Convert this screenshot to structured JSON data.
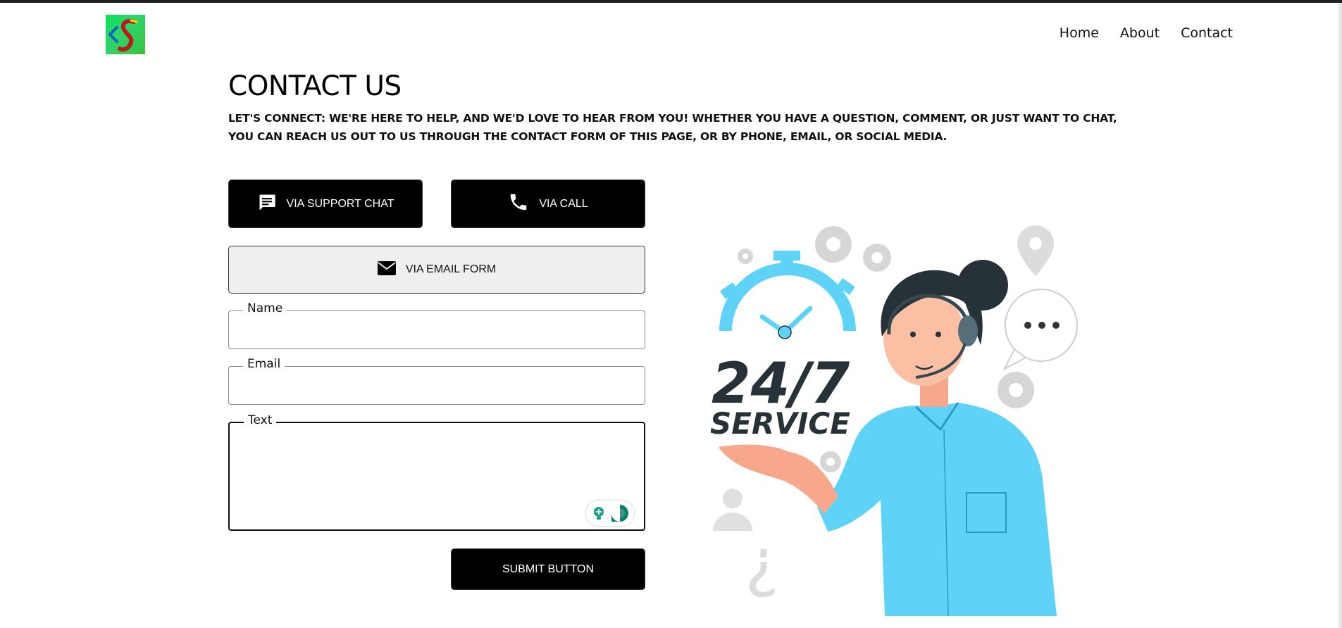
{
  "nav": {
    "items": [
      "Home",
      "About",
      "Contact"
    ]
  },
  "page": {
    "title": "CONTACT US",
    "subtitle": "LET'S CONNECT: WE'RE HERE TO HELP, AND WE'D LOVE TO HEAR FROM YOU! WHETHER YOU HAVE A QUESTION, COMMENT, OR JUST WANT TO CHAT, YOU CAN REACH US OUT TO US THROUGH THE CONTACT FORM OF THIS PAGE, OR BY PHONE, EMAIL, OR SOCIAL MEDIA."
  },
  "contact_options": {
    "chat_label": "VIA SUPPORT CHAT",
    "call_label": "VIA CALL",
    "email_label": "VIA EMAIL FORM"
  },
  "form": {
    "name_label": "Name",
    "name_value": "",
    "email_label": "Email",
    "email_value": "",
    "text_label": "Text",
    "text_value": "",
    "submit_label": "SUBMIT BUTTON"
  },
  "illustration": {
    "headline": "24/7",
    "tagline": "SERVICE"
  },
  "icons": {
    "logo": "logo-icon",
    "chat": "chat-bubble-icon",
    "call": "phone-icon",
    "email": "envelope-icon",
    "grammarly": "grammarly-icon"
  },
  "colors": {
    "button_dark": "#000000",
    "button_light": "#efefef",
    "accent_blue": "#5fd3f7"
  }
}
